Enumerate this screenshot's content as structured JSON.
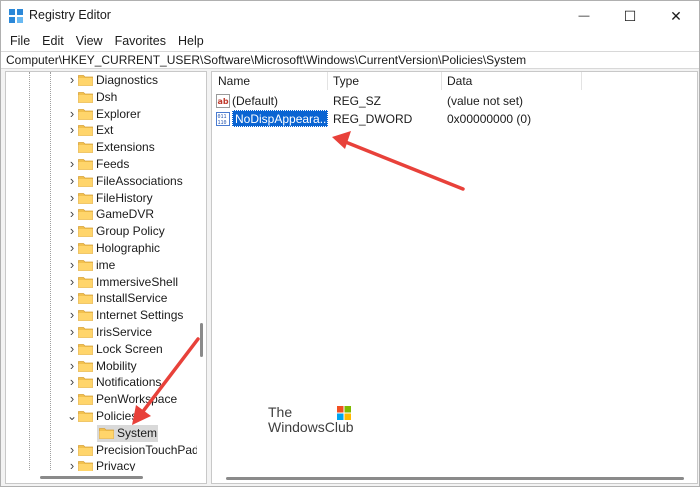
{
  "window": {
    "title": "Registry Editor",
    "minimize_glyph": "—",
    "maximize_glyph": "☐",
    "close_glyph": "✕"
  },
  "menu": [
    "File",
    "Edit",
    "View",
    "Favorites",
    "Help"
  ],
  "address": "Computer\\HKEY_CURRENT_USER\\Software\\Microsoft\\Windows\\CurrentVersion\\Policies\\System",
  "tree": {
    "items": [
      {
        "label": "Diagnostics",
        "expandable": true
      },
      {
        "label": "Dsh",
        "expandable": false
      },
      {
        "label": "Explorer",
        "expandable": true
      },
      {
        "label": "Ext",
        "expandable": true
      },
      {
        "label": "Extensions",
        "expandable": false
      },
      {
        "label": "Feeds",
        "expandable": true
      },
      {
        "label": "FileAssociations",
        "expandable": true
      },
      {
        "label": "FileHistory",
        "expandable": true
      },
      {
        "label": "GameDVR",
        "expandable": true
      },
      {
        "label": "Group Policy",
        "expandable": true
      },
      {
        "label": "Holographic",
        "expandable": true
      },
      {
        "label": "ime",
        "expandable": true
      },
      {
        "label": "ImmersiveShell",
        "expandable": true
      },
      {
        "label": "InstallService",
        "expandable": true
      },
      {
        "label": "Internet Settings",
        "expandable": true
      },
      {
        "label": "IrisService",
        "expandable": true
      },
      {
        "label": "Lock Screen",
        "expandable": true
      },
      {
        "label": "Mobility",
        "expandable": true
      },
      {
        "label": "Notifications",
        "expandable": true
      },
      {
        "label": "PenWorkspace",
        "expandable": true
      },
      {
        "label": "Policies",
        "expandable": true,
        "expanded": true
      },
      {
        "label": "System",
        "expandable": false,
        "child": true,
        "selected": true
      },
      {
        "label": "PrecisionTouchPad",
        "expandable": true
      },
      {
        "label": "Privacy",
        "expandable": true
      }
    ]
  },
  "list": {
    "columns": [
      "Name",
      "Type",
      "Data"
    ],
    "rows": [
      {
        "name": "(Default)",
        "type": "REG_SZ",
        "data": "(value not set)",
        "icon": "string-value-icon"
      },
      {
        "name": "NoDispAppeara...",
        "type": "REG_DWORD",
        "data": "0x00000000 (0)",
        "icon": "binary-value-icon",
        "selected": true
      }
    ]
  },
  "watermark": {
    "line1": "The",
    "line2": "WindowsClub"
  },
  "colors": {
    "selection": "#0a64d2",
    "folder": "#f2c14e",
    "arrow": "#e8413a"
  }
}
